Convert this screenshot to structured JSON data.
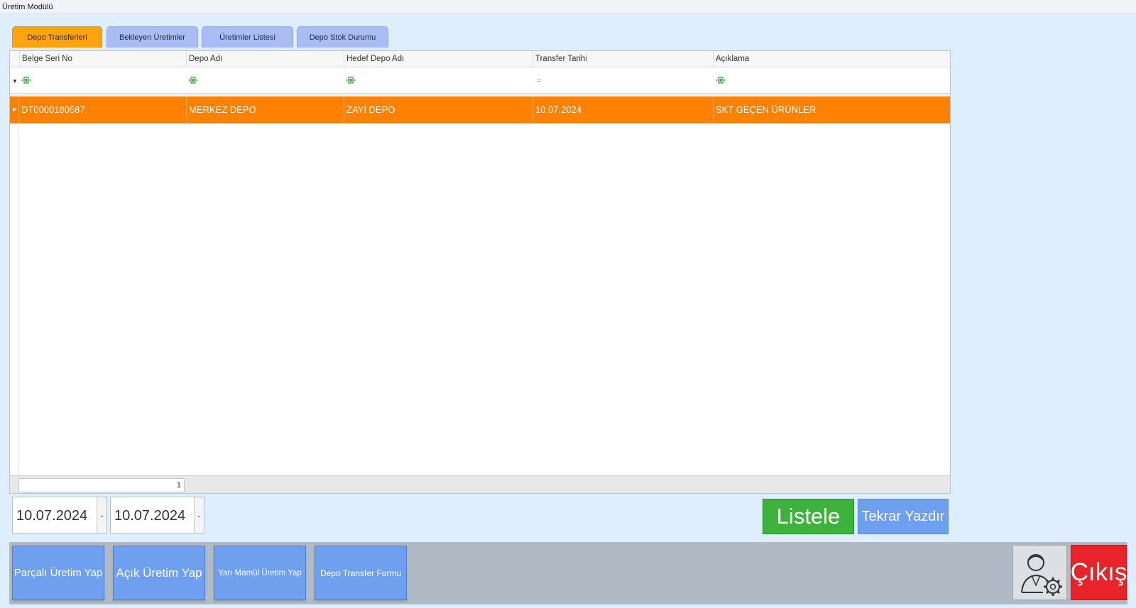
{
  "window": {
    "title": "Üretim Modülü"
  },
  "tabs": [
    {
      "label": "Depo Transferleri",
      "active": true
    },
    {
      "label": "Bekleyen Üretimler",
      "active": false
    },
    {
      "label": "Üretimler Listesi",
      "active": false
    },
    {
      "label": "Depo Stok Durumu",
      "active": false
    }
  ],
  "grid": {
    "columns": [
      "Belge Seri No",
      "Depo Adı",
      "Hedef Depo Adı",
      "Transfer Tarihi",
      "Açıklama"
    ],
    "filter_row": {
      "date_operator": "="
    },
    "rows": [
      [
        "DT0000180587",
        "MERKEZ DEPO",
        "ZAYİ DEPO",
        "10.07.2024",
        "SKT GEÇEN ÜRÜNLER"
      ]
    ],
    "footer_count": "1"
  },
  "date_filter": {
    "start": "10.07.2024",
    "end": "10.07.2024"
  },
  "actions": {
    "list": "Listele",
    "reprint": "Tekrar Yazdır"
  },
  "bottom_buttons": [
    "Parçalı Üretim Yap",
    "Açık Üretim Yap",
    "Yarı Mamül Üretim Yap",
    "Depo Transfer Formu"
  ],
  "exit": "Çıkış",
  "colors": {
    "active_tab": "#ffa40f",
    "inactive_tab": "#a9bcf4",
    "selected_row": "#ff8102",
    "list_button": "#3db33d",
    "blue_button": "#6ea0ef",
    "exit_button": "#e8242a",
    "background": "#dfeefc"
  },
  "icons": {
    "user_settings": "user-settings-icon",
    "filter": "filter-contains-icon",
    "dropdown": "chevron-down-icon"
  }
}
